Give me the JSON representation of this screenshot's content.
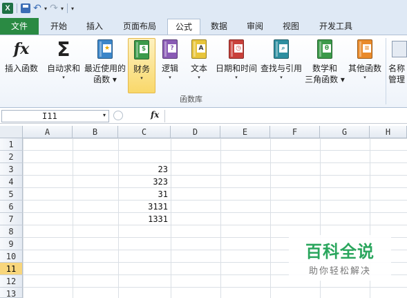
{
  "quick_access": {
    "excel_icon": "excel-logo-icon",
    "save_icon": "save-icon",
    "undo_icon": "undo-icon",
    "redo_icon": "redo-icon",
    "customize_icon": "customize-arrow-icon"
  },
  "tabs": [
    {
      "label": "文件"
    },
    {
      "label": "开始"
    },
    {
      "label": "插入"
    },
    {
      "label": "页面布局"
    },
    {
      "label": "公式"
    },
    {
      "label": "数据"
    },
    {
      "label": "审阅"
    },
    {
      "label": "视图"
    },
    {
      "label": "开发工具"
    }
  ],
  "ribbon": {
    "insert_function": {
      "label": "插入函数",
      "symbol": "fx"
    },
    "autosum": {
      "label": "自动求和",
      "symbol": "Σ"
    },
    "recent": {
      "label1": "最近使用的",
      "label2": "函数"
    },
    "financial": {
      "label": "财务"
    },
    "logical": {
      "label": "逻辑",
      "symbol": "?"
    },
    "text": {
      "label": "文本",
      "symbol": "A"
    },
    "datetime": {
      "label": "日期和时间"
    },
    "lookup": {
      "label": "查找与引用"
    },
    "math": {
      "label1": "数学和",
      "label2": "三角函数",
      "symbol": "θ"
    },
    "more": {
      "label": "其他函数"
    },
    "name_manager": {
      "label1": "名称",
      "label2": "管理"
    },
    "group_label": "函数库",
    "colors": {
      "financial_highlight": "#f9d86a",
      "book_blue": "#3c86c9",
      "book_purple": "#8a5bb5",
      "book_yellow": "#e8c53a",
      "book_red": "#c9403a",
      "book_teal": "#2f8fa0",
      "book_green": "#3c9a4a",
      "book_orange": "#e98a2a"
    }
  },
  "formula_bar": {
    "name_box": "I11",
    "fx_label": "fx",
    "formula": ""
  },
  "grid": {
    "columns": [
      "A",
      "B",
      "C",
      "D",
      "E",
      "F",
      "G",
      "H"
    ],
    "rows": [
      "1",
      "2",
      "3",
      "4",
      "5",
      "6",
      "7",
      "8",
      "9",
      "10",
      "11",
      "12",
      "13"
    ],
    "selected_row": "11",
    "values": {
      "C3": "23",
      "C4": "323",
      "C5": "31",
      "C6": "3131",
      "C7": "1331"
    }
  },
  "watermark": {
    "title": "百科全说",
    "subtitle": "助你轻松解决",
    "color": "#2aa65d"
  }
}
